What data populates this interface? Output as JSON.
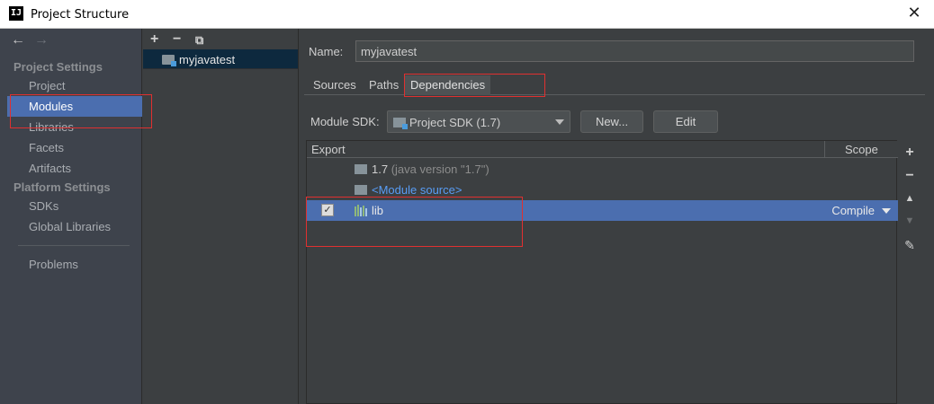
{
  "window": {
    "title": "Project Structure",
    "app_icon_text": "IJ"
  },
  "sidebar": {
    "sections": [
      {
        "label": "Project Settings"
      },
      {
        "label": "Platform Settings"
      }
    ],
    "items": [
      {
        "label": "Project"
      },
      {
        "label": "Modules",
        "selected": true
      },
      {
        "label": "Libraries"
      },
      {
        "label": "Facets"
      },
      {
        "label": "Artifacts"
      },
      {
        "label": "SDKs"
      },
      {
        "label": "Global Libraries"
      },
      {
        "label": "Problems"
      }
    ]
  },
  "modules": {
    "items": [
      {
        "label": "myjavatest"
      }
    ]
  },
  "main": {
    "name_label": "Name:",
    "name_value": "myjavatest",
    "tabs": [
      {
        "label": "Sources"
      },
      {
        "label": "Paths"
      },
      {
        "label": "Dependencies",
        "active": true
      }
    ],
    "sdk_label": "Module SDK:",
    "sdk_value": "Project SDK (1.7)",
    "new_button": "New...",
    "edit_button": "Edit",
    "table": {
      "headers": {
        "export": "Export",
        "scope": "Scope"
      },
      "rows": [
        {
          "name": "1.7",
          "detail": "(java version \"1.7\")"
        },
        {
          "name": "<Module source>"
        },
        {
          "name": "lib",
          "checked": true,
          "scope": "Compile",
          "selected": true
        }
      ]
    }
  },
  "colors": {
    "selection": "#4b6eaf",
    "annotation": "#e03030",
    "link": "#589df6"
  }
}
